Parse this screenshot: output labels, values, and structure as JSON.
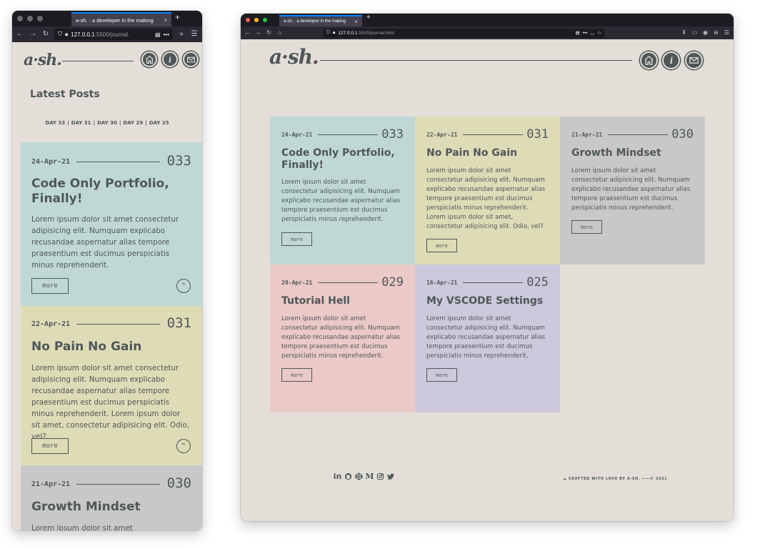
{
  "browser": {
    "tab_title": "a-sh. : a developer in the making",
    "tab_close": "×",
    "new_tab": "+",
    "url_host": "127.0.0.1",
    "url_path_mobile": ":5500/journal.",
    "url_path_desktop": ":5500/journal.html",
    "overflow_menu": "•••",
    "chevron_more": "»"
  },
  "site": {
    "logo": "a·sh.",
    "nav_icons": [
      "home-icon",
      "info-icon",
      "mail-icon"
    ],
    "latest_posts_heading": "Latest Posts",
    "day_nav": [
      "DAY 33",
      "DAY 31",
      "DAY 30",
      "DAY 29",
      "DAY 25"
    ],
    "day_nav_separator": "|"
  },
  "colors": {
    "page_bg": "#e3dfd8",
    "ink": "#4f5759",
    "card_teal": "#bfd8d5",
    "card_khaki": "#dedbb7",
    "card_grey": "#c8c8c8",
    "card_pink": "#eac9c6",
    "card_lavender": "#ccc9dc"
  },
  "posts": [
    {
      "date": "24-Apr-21",
      "number": "033",
      "title": "Code Only Portfolio, Finally!",
      "body": "Lorem ipsum dolor sit amet consectetur adipisicing elit. Numquam explicabo recusandae aspernatur alias tempore praesentium est ducimus perspiciatis minus reprehenderit.",
      "more": "more",
      "color": "#bfd8d5"
    },
    {
      "date": "22-Apr-21",
      "number": "031",
      "title": "No Pain No Gain",
      "body": "Lorem ipsum dolor sit amet consectetur adipisicing elit. Numquam explicabo recusandae aspernatur alias tempore praesentium est ducimus perspiciatis minus reprehenderit. Lorem ipsum dolor sit amet, consectetur adipisicing elit. Odio, vel?",
      "more": "more",
      "color": "#dedbb7"
    },
    {
      "date": "21-Apr-21",
      "number": "030",
      "title": "Growth Mindset",
      "body": "Lorem ipsum dolor sit amet consectetur adipisicing elit. Numquam explicabo recusandae aspernatur alias tempore praesentium est ducimus perspiciatis minus reprehenderit.",
      "more": "more",
      "color": "#c8c8c8"
    },
    {
      "date": "20-Apr-21",
      "number": "029",
      "title": "Tutorial Hell",
      "body": "Lorem ipsum dolor sit amet consectetur adipisicing elit. Numquam explicabo recusandae aspernatur alias tempore praesentium est ducimus perspiciatis minus reprehenderit.",
      "more": "more",
      "color": "#eac9c6"
    },
    {
      "date": "16-Apr-21",
      "number": "025",
      "title": "My VSCODE Settings",
      "body": "Lorem ipsum dolor sit amet consectetur adipisicing elit. Numquam explicabo recusandae aspernatur alias tempore praesentium est ducimus perspiciatis minus reprehenderit.",
      "more": "more",
      "color": "#ccc9dc"
    }
  ],
  "mobile_partial_body": "Lorem ipsum dolor sit amet",
  "footer": {
    "social_icons": [
      "linkedin-icon",
      "github-icon",
      "codepen-icon",
      "medium-icon",
      "instagram-icon",
      "twitter-icon"
    ],
    "social_glyphs": [
      "in",
      "",
      "",
      "M",
      "",
      ""
    ],
    "credit": "☁ CRAFTED WITH LOVE BY A-SH. ——© 2021"
  }
}
